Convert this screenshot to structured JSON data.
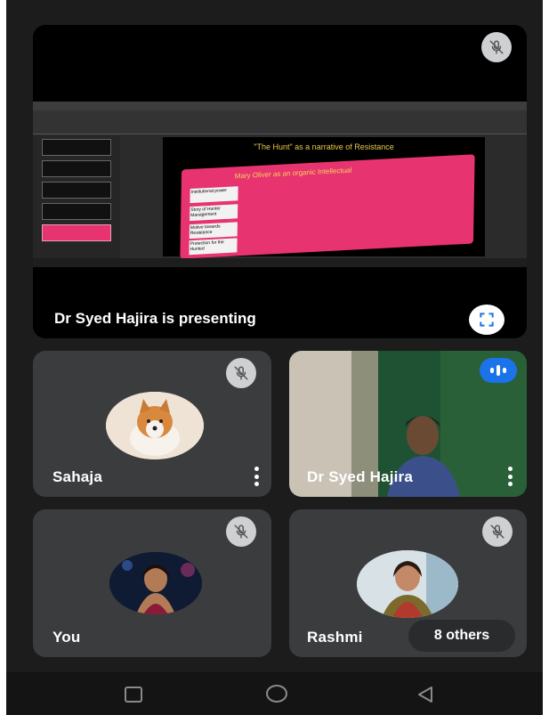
{
  "presentation": {
    "presenting_label": "Dr Syed Hajira is presenting",
    "slide_title": "\"The Hunt\" as a narrative of Resistance",
    "slide_heading": "Mary Oliver as an organic Intellectual",
    "slide_items": [
      "Institutional power",
      "Story of Hunter Management",
      "Motive towards Resistance",
      "Protection for the Hunted"
    ],
    "fullscreen_icon": "fullscreen-icon"
  },
  "participants": [
    {
      "name": "Sahaja",
      "muted": true,
      "avatar": "dog-avatar"
    },
    {
      "name": "Dr Syed Hajira",
      "muted": false,
      "speaking": true
    },
    {
      "name": "You",
      "muted": true,
      "avatar": "woman-avatar"
    },
    {
      "name": "Rashmi",
      "muted": true,
      "avatar": "woman-avatar-2"
    }
  ],
  "others_chip": "8 others",
  "colors": {
    "tile_bg": "#3b3c3e",
    "speaking_blue": "#1a73e8",
    "slide_pink": "#e7336f",
    "mute_bg": "#cfd0d2"
  },
  "nav": {
    "recent": "recent-apps-icon",
    "home": "home-icon",
    "back": "back-icon"
  }
}
